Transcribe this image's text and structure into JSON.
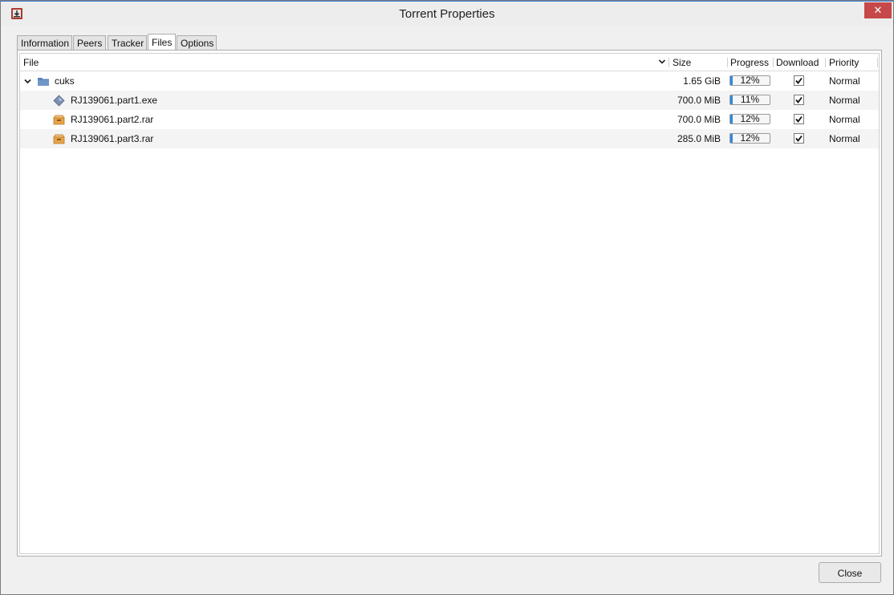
{
  "window": {
    "title": "Torrent Properties",
    "close_glyph": "✕"
  },
  "tabs": [
    {
      "label": "Information"
    },
    {
      "label": "Peers"
    },
    {
      "label": "Tracker"
    },
    {
      "label": "Files",
      "active": true
    },
    {
      "label": "Options"
    }
  ],
  "columns": {
    "file": "File",
    "size": "Size",
    "progress": "Progress",
    "download": "Download",
    "priority": "Priority"
  },
  "rows": [
    {
      "name": "cuks",
      "size": "1.65 GiB",
      "progress_pct": 12,
      "progress_label": "12%",
      "download": true,
      "priority": "Normal",
      "icon": "folder-icon"
    },
    {
      "name": "RJ139061.part1.exe",
      "size": "700.0 MiB",
      "progress_pct": 11,
      "progress_label": "11%",
      "download": true,
      "priority": "Normal",
      "icon": "executable-icon"
    },
    {
      "name": "RJ139061.part2.rar",
      "size": "700.0 MiB",
      "progress_pct": 12,
      "progress_label": "12%",
      "download": true,
      "priority": "Normal",
      "icon": "archive-icon"
    },
    {
      "name": "RJ139061.part3.rar",
      "size": "285.0 MiB",
      "progress_pct": 12,
      "progress_label": "12%",
      "download": true,
      "priority": "Normal",
      "icon": "archive-icon"
    }
  ],
  "footer": {
    "close_label": "Close"
  },
  "colors": {
    "progress_fill": "#2f8ae0",
    "close_button": "#c74848",
    "folder": "#5b84b8",
    "archive": "#e8a34a"
  }
}
